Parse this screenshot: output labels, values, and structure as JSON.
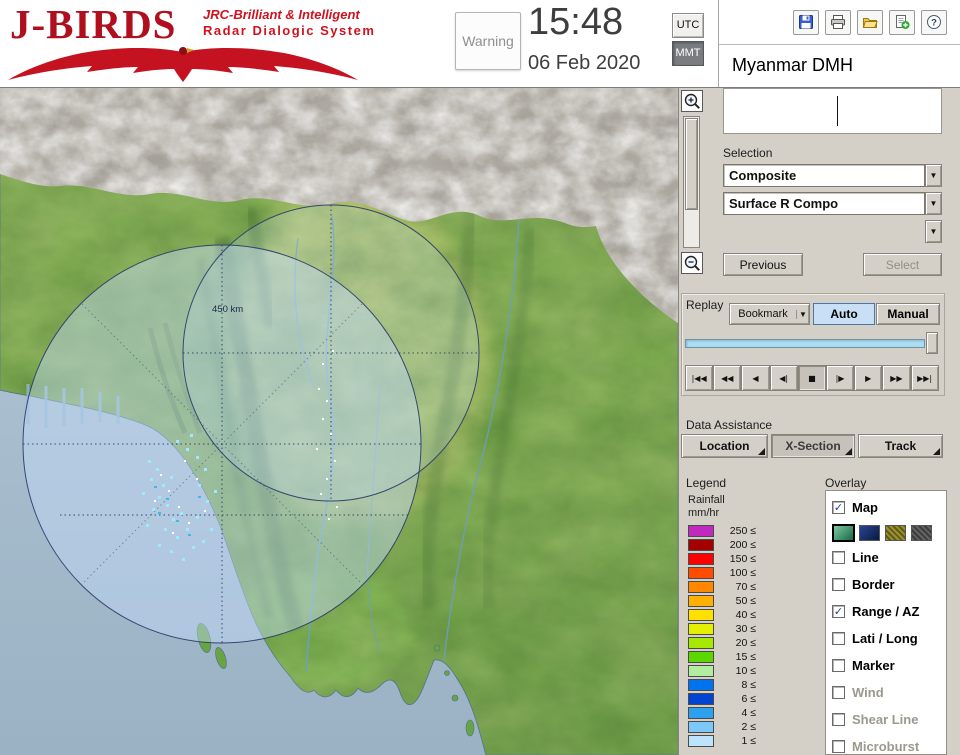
{
  "header": {
    "logo_title": "J-BIRDS",
    "logo_tagline1": "JRC-Brilliant & Intelligent",
    "logo_tagline2": "Radar  Dialogic  System",
    "warning_label": "Warning",
    "time": "15:48",
    "date": "06 Feb 2020",
    "tz_utc": "UTC",
    "tz_mmt": "MMT",
    "tz_selected": "MMT",
    "station_name": "Myanmar DMH",
    "toolbar_icons": [
      "save",
      "print",
      "open-folder",
      "add-image",
      "help"
    ]
  },
  "map": {
    "range_ring_label": "450 km",
    "zoom_controls": [
      "zoom-in-magnifier",
      "zoom-out-magnifier"
    ]
  },
  "panel": {
    "selection_label": "Selection",
    "combo_composite": "Composite",
    "combo_product": "Surface R Compo",
    "combo_third": "",
    "previous_button": "Previous",
    "select_button": "Select",
    "replay": {
      "label": "Replay",
      "bookmark_button": "Bookmark",
      "auto_button": "Auto",
      "manual_button": "Manual",
      "playback_buttons": [
        "|◀◀",
        "◀◀",
        "◀",
        "◀|",
        "■",
        "|▶",
        "▶",
        "▶▶",
        "▶▶|"
      ]
    },
    "data_assistance": {
      "label": "Data Assistance",
      "buttons": [
        "Location",
        "X-Section",
        "Track"
      ]
    },
    "legend": {
      "label": "Legend",
      "unit_line1": "Rainfall",
      "unit_line2": "mm/hr",
      "rows": [
        {
          "value": "250 ≤",
          "color": "#c028c0"
        },
        {
          "value": "200 ≤",
          "color": "#a40000"
        },
        {
          "value": "150 ≤",
          "color": "#ff0000"
        },
        {
          "value": "100 ≤",
          "color": "#ff4c00"
        },
        {
          "value": "70 ≤",
          "color": "#ff8800"
        },
        {
          "value": "50 ≤",
          "color": "#ffb000"
        },
        {
          "value": "40 ≤",
          "color": "#ffe000"
        },
        {
          "value": "30 ≤",
          "color": "#e4f000"
        },
        {
          "value": "20 ≤",
          "color": "#a6e800"
        },
        {
          "value": "15 ≤",
          "color": "#5cd800"
        },
        {
          "value": "10 ≤",
          "color": "#b2eea0"
        },
        {
          "value": "8 ≤",
          "color": "#0074f0"
        },
        {
          "value": "6 ≤",
          "color": "#0044d4"
        },
        {
          "value": "4 ≤",
          "color": "#2ea0f0"
        },
        {
          "value": "2 ≤",
          "color": "#7cc8f8"
        },
        {
          "value": "1 ≤",
          "color": "#bce4fc"
        }
      ]
    },
    "overlay": {
      "label": "Overlay",
      "items": [
        {
          "label": "Map",
          "checked": true,
          "enabled": true
        },
        {
          "label": "Line",
          "checked": false,
          "enabled": true
        },
        {
          "label": "Border",
          "checked": false,
          "enabled": true
        },
        {
          "label": "Range / AZ",
          "checked": true,
          "enabled": true
        },
        {
          "label": "Lati / Long",
          "checked": false,
          "enabled": true
        },
        {
          "label": "Marker",
          "checked": false,
          "enabled": true
        },
        {
          "label": "Wind",
          "checked": false,
          "enabled": false
        },
        {
          "label": "Shear Line",
          "checked": false,
          "enabled": false
        },
        {
          "label": "Microburst",
          "checked": false,
          "enabled": false
        }
      ],
      "map_styles": [
        {
          "name": "terrain",
          "color": "#2aa06a",
          "selected": true
        },
        {
          "name": "navy",
          "color": "#0e2a6e",
          "selected": false
        },
        {
          "name": "olive",
          "color": "#5e5c16",
          "selected": false
        },
        {
          "name": "dark",
          "color": "#3c3c3c",
          "selected": false
        }
      ]
    }
  }
}
